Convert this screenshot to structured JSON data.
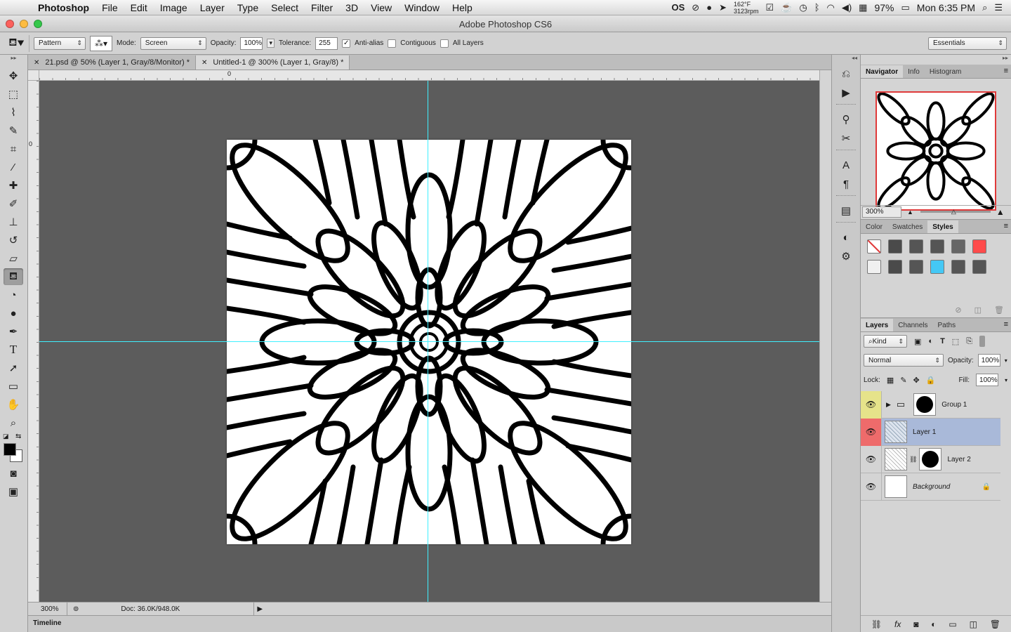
{
  "menubar": {
    "app": "Photoshop",
    "items": [
      "File",
      "Edit",
      "Image",
      "Layer",
      "Type",
      "Select",
      "Filter",
      "3D",
      "View",
      "Window",
      "Help"
    ],
    "temp": "162°F",
    "rpm": "3123rpm",
    "battery": "97%",
    "clock": "Mon 6:35 PM"
  },
  "window": {
    "title": "Adobe Photoshop CS6"
  },
  "options": {
    "fill_source": "Pattern",
    "mode_label": "Mode:",
    "mode": "Screen",
    "opacity_label": "Opacity:",
    "opacity": "100%",
    "tolerance_label": "Tolerance:",
    "tolerance": "255",
    "antialias": "Anti-alias",
    "contiguous": "Contiguous",
    "all_layers": "All Layers",
    "workspace": "Essentials"
  },
  "tabs": [
    {
      "label": "21.psd @ 50% (Layer 1, Gray/8/Monitor) *"
    },
    {
      "label": "Untitled-1 @ 300% (Layer 1, Gray/8) *"
    }
  ],
  "rulers": {
    "h_zero": "0",
    "v_zero": "0"
  },
  "status": {
    "zoom": "300%",
    "doc": "Doc: 36.0K/948.0K"
  },
  "timeline": {
    "label": "Timeline"
  },
  "navigator": {
    "tabs": [
      "Navigator",
      "Info",
      "Histogram"
    ],
    "zoom": "300%"
  },
  "color_panel": {
    "tabs": [
      "Color",
      "Swatches",
      "Styles"
    ],
    "swatches": [
      "#ffffff",
      "#4a4a4a",
      "#555555",
      "#555555",
      "#666666",
      "#ff4b4b",
      "#f0f0f0",
      "#4a4a4a",
      "#555555",
      "#44c8f5",
      "#555555",
      "#555555"
    ]
  },
  "layers": {
    "tabs": [
      "Layers",
      "Channels",
      "Paths"
    ],
    "kind": "Kind",
    "blend": "Normal",
    "opacity_label": "Opacity:",
    "opacity": "100%",
    "lock_label": "Lock:",
    "fill_label": "Fill:",
    "fill": "100%",
    "rows": [
      {
        "name": "Group 1",
        "color": "#e6e38a"
      },
      {
        "name": "Layer 1",
        "color": "#ee6b6b"
      },
      {
        "name": "Layer 2",
        "color": ""
      },
      {
        "name": "Background",
        "color": ""
      }
    ]
  }
}
